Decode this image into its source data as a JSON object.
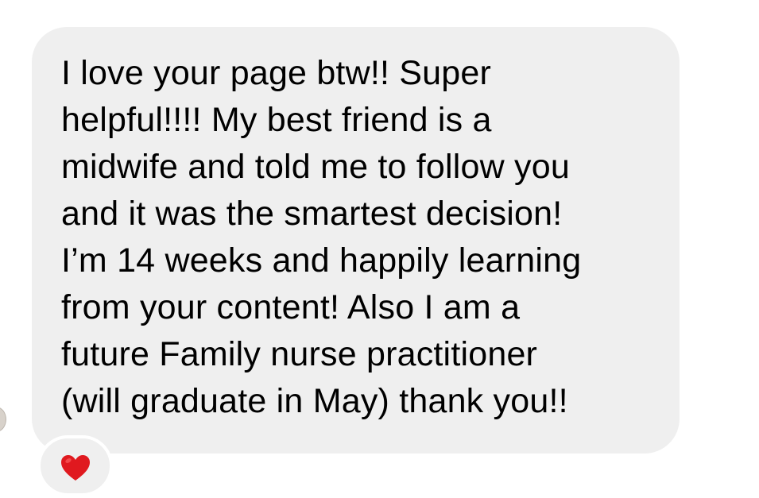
{
  "message": {
    "lines": [
      "I love your page btw!! Super",
      "helpful!!!! My best friend is a",
      "midwife and told me to follow you",
      "and it was the smartest decision!",
      "I’m 14 weeks and happily learning",
      "from your content! Also I am a",
      "future Family nurse practitioner",
      "(will graduate in May) thank you!!"
    ]
  },
  "reaction": {
    "icon": "heart-icon",
    "color": "#e0191f"
  },
  "colors": {
    "bubble": "#efefef",
    "background": "#ffffff",
    "text": "#000000"
  }
}
